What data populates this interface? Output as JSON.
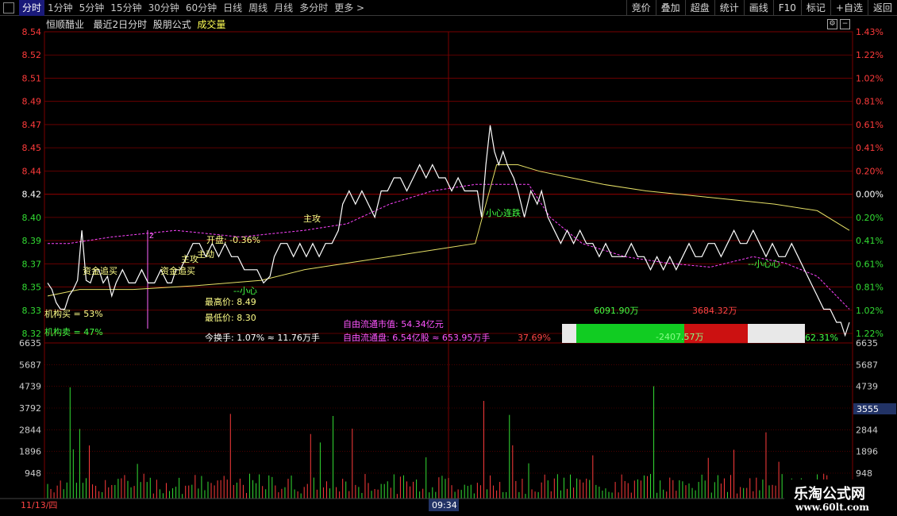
{
  "toolbar": {
    "tabs": [
      "分时",
      "1分钟",
      "5分钟",
      "15分钟",
      "30分钟",
      "60分钟",
      "日线",
      "周线",
      "月线",
      "多分时",
      "更多 >"
    ],
    "active_tab": 0,
    "buttons": [
      "竞价",
      "叠加",
      "超盘",
      "统计",
      "画线",
      "F10",
      "标记",
      "+自选",
      "返回"
    ]
  },
  "header": {
    "stock_name": "恒顺醋业",
    "subtitle": "最近2日分时",
    "formula": "股朋公式",
    "volume_label": "成交量"
  },
  "colors": {
    "up": "#ff3b3b",
    "down": "#33dd33",
    "neutral": "#ffffff",
    "avg_line": "#e6e066",
    "pink_line": "#ff44ff",
    "grid": "#7a0000",
    "text_yellow": "#ffff55",
    "text_magenta": "#ff55ff"
  },
  "annotations": {
    "open": "开盘: -0.36%",
    "high": "最高价: 8.49",
    "low": "最低价: 8.30",
    "turnover": "今换手: 1.07% ≈ 11.76万手",
    "float_value": "自由流通市值: 54.34亿元",
    "float_shares": "自由流通盘: 6.54亿股 ≈ 653.95万手",
    "inst_buy": "机构买 = 53%",
    "inst_sell": "机构卖 = 47%",
    "fund_chase_1": "资金追买",
    "fund_chase_2": "资金追买",
    "main_buy": "主攻",
    "main_attack": "主攻",
    "careful_1": "--小心",
    "careful_2": "小心连跌",
    "careful_3": "--小心心",
    "zhu": "主动",
    "z_mark": "z"
  },
  "flow_bar": {
    "green_amount": "6091.90万",
    "red_amount": "3684.32万",
    "net": "-2407.57万",
    "left_pct": "37.69%",
    "right_pct": "62.31%"
  },
  "footer": {
    "date": "11/13/四",
    "time": "09:34"
  },
  "chart_data": {
    "type": "line",
    "price_axis_labels": [
      "8.54",
      "8.52",
      "8.51",
      "8.49",
      "8.47",
      "8.45",
      "8.44",
      "8.42",
      "8.40",
      "8.39",
      "8.37",
      "8.35",
      "8.33",
      "8.32"
    ],
    "pct_axis_labels": [
      "1.43%",
      "1.22%",
      "1.02%",
      "0.81%",
      "0.61%",
      "0.41%",
      "0.20%",
      "0.00%",
      "0.20%",
      "0.41%",
      "0.61%",
      "0.81%",
      "1.02%",
      "1.22%"
    ],
    "ylim": [
      8.32,
      8.54
    ],
    "volume_axis_labels": [
      "6635",
      "5687",
      "4739",
      "3792",
      "2844",
      "1896",
      "948"
    ],
    "volume_ylim": [
      0,
      6635
    ],
    "volume_marker": "3555",
    "price_series": [
      [
        0,
        8.35
      ],
      [
        4,
        8.345
      ],
      [
        8,
        8.335
      ],
      [
        12,
        8.33
      ],
      [
        16,
        8.33
      ],
      [
        20,
        8.34
      ],
      [
        24,
        8.345
      ],
      [
        28,
        8.352
      ],
      [
        32,
        8.39
      ],
      [
        36,
        8.352
      ],
      [
        40,
        8.35
      ],
      [
        44,
        8.36
      ],
      [
        48,
        8.36
      ],
      [
        52,
        8.35
      ],
      [
        56,
        8.355
      ],
      [
        60,
        8.34
      ],
      [
        64,
        8.35
      ],
      [
        70,
        8.36
      ],
      [
        76,
        8.35
      ],
      [
        82,
        8.35
      ],
      [
        88,
        8.36
      ],
      [
        94,
        8.35
      ],
      [
        100,
        8.35
      ],
      [
        106,
        8.36
      ],
      [
        112,
        8.35
      ],
      [
        116,
        8.35
      ],
      [
        120,
        8.36
      ],
      [
        124,
        8.36
      ],
      [
        130,
        8.37
      ],
      [
        136,
        8.38
      ],
      [
        142,
        8.38
      ],
      [
        148,
        8.37
      ],
      [
        154,
        8.38
      ],
      [
        160,
        8.37
      ],
      [
        166,
        8.38
      ],
      [
        172,
        8.37
      ],
      [
        178,
        8.37
      ],
      [
        184,
        8.36
      ],
      [
        190,
        8.36
      ],
      [
        196,
        8.36
      ],
      [
        202,
        8.35
      ],
      [
        208,
        8.355
      ],
      [
        212,
        8.37
      ],
      [
        218,
        8.38
      ],
      [
        224,
        8.38
      ],
      [
        230,
        8.37
      ],
      [
        236,
        8.38
      ],
      [
        242,
        8.37
      ],
      [
        248,
        8.38
      ],
      [
        254,
        8.37
      ],
      [
        260,
        8.38
      ],
      [
        266,
        8.38
      ],
      [
        272,
        8.39
      ],
      [
        276,
        8.41
      ],
      [
        282,
        8.42
      ],
      [
        288,
        8.41
      ],
      [
        294,
        8.42
      ],
      [
        300,
        8.41
      ],
      [
        306,
        8.4
      ],
      [
        312,
        8.42
      ],
      [
        318,
        8.42
      ],
      [
        324,
        8.43
      ],
      [
        330,
        8.43
      ],
      [
        336,
        8.42
      ],
      [
        342,
        8.43
      ],
      [
        348,
        8.44
      ],
      [
        354,
        8.43
      ],
      [
        360,
        8.44
      ],
      [
        366,
        8.43
      ],
      [
        372,
        8.43
      ],
      [
        378,
        8.42
      ],
      [
        384,
        8.43
      ],
      [
        390,
        8.42
      ],
      [
        396,
        8.42
      ],
      [
        402,
        8.42
      ],
      [
        406,
        8.4
      ],
      [
        410,
        8.44
      ],
      [
        414,
        8.47
      ],
      [
        418,
        8.45
      ],
      [
        422,
        8.44
      ],
      [
        426,
        8.45
      ],
      [
        430,
        8.44
      ],
      [
        436,
        8.43
      ],
      [
        440,
        8.42
      ],
      [
        446,
        8.4
      ],
      [
        452,
        8.42
      ],
      [
        458,
        8.41
      ],
      [
        462,
        8.42
      ],
      [
        468,
        8.4
      ],
      [
        474,
        8.39
      ],
      [
        480,
        8.38
      ],
      [
        486,
        8.39
      ],
      [
        492,
        8.38
      ],
      [
        498,
        8.39
      ],
      [
        504,
        8.38
      ],
      [
        510,
        8.38
      ],
      [
        516,
        8.37
      ],
      [
        522,
        8.38
      ],
      [
        528,
        8.37
      ],
      [
        534,
        8.37
      ],
      [
        540,
        8.37
      ],
      [
        546,
        8.38
      ],
      [
        552,
        8.37
      ],
      [
        558,
        8.37
      ],
      [
        564,
        8.36
      ],
      [
        570,
        8.37
      ],
      [
        576,
        8.36
      ],
      [
        582,
        8.37
      ],
      [
        588,
        8.36
      ],
      [
        594,
        8.37
      ],
      [
        600,
        8.38
      ],
      [
        606,
        8.37
      ],
      [
        612,
        8.37
      ],
      [
        618,
        8.38
      ],
      [
        624,
        8.38
      ],
      [
        630,
        8.37
      ],
      [
        636,
        8.38
      ],
      [
        642,
        8.39
      ],
      [
        648,
        8.38
      ],
      [
        654,
        8.38
      ],
      [
        660,
        8.39
      ],
      [
        666,
        8.38
      ],
      [
        672,
        8.37
      ],
      [
        678,
        8.38
      ],
      [
        684,
        8.37
      ],
      [
        690,
        8.37
      ],
      [
        696,
        8.38
      ],
      [
        702,
        8.37
      ],
      [
        708,
        8.36
      ],
      [
        714,
        8.35
      ],
      [
        720,
        8.34
      ],
      [
        726,
        8.33
      ],
      [
        732,
        8.33
      ],
      [
        738,
        8.32
      ],
      [
        742,
        8.32
      ],
      [
        746,
        8.31
      ],
      [
        750,
        8.32
      ]
    ],
    "avg_series": [
      [
        0,
        8.34
      ],
      [
        30,
        8.345
      ],
      [
        80,
        8.345
      ],
      [
        140,
        8.348
      ],
      [
        200,
        8.352
      ],
      [
        240,
        8.36
      ],
      [
        280,
        8.365
      ],
      [
        320,
        8.37
      ],
      [
        360,
        8.375
      ],
      [
        400,
        8.38
      ],
      [
        410,
        8.41
      ],
      [
        420,
        8.44
      ],
      [
        440,
        8.44
      ],
      [
        460,
        8.435
      ],
      [
        490,
        8.43
      ],
      [
        520,
        8.425
      ],
      [
        560,
        8.42
      ],
      [
        620,
        8.415
      ],
      [
        680,
        8.41
      ],
      [
        720,
        8.405
      ],
      [
        750,
        8.39
      ]
    ],
    "pink_series": [
      [
        0,
        8.38
      ],
      [
        20,
        8.38
      ],
      [
        60,
        8.385
      ],
      [
        120,
        8.39
      ],
      [
        180,
        8.385
      ],
      [
        240,
        8.39
      ],
      [
        280,
        8.395
      ],
      [
        320,
        8.41
      ],
      [
        360,
        8.42
      ],
      [
        400,
        8.425
      ],
      [
        420,
        8.425
      ],
      [
        450,
        8.425
      ],
      [
        470,
        8.4
      ],
      [
        500,
        8.38
      ],
      [
        540,
        8.37
      ],
      [
        580,
        8.365
      ],
      [
        620,
        8.362
      ],
      [
        660,
        8.37
      ],
      [
        690,
        8.365
      ],
      [
        720,
        8.355
      ],
      [
        750,
        8.33
      ]
    ]
  }
}
